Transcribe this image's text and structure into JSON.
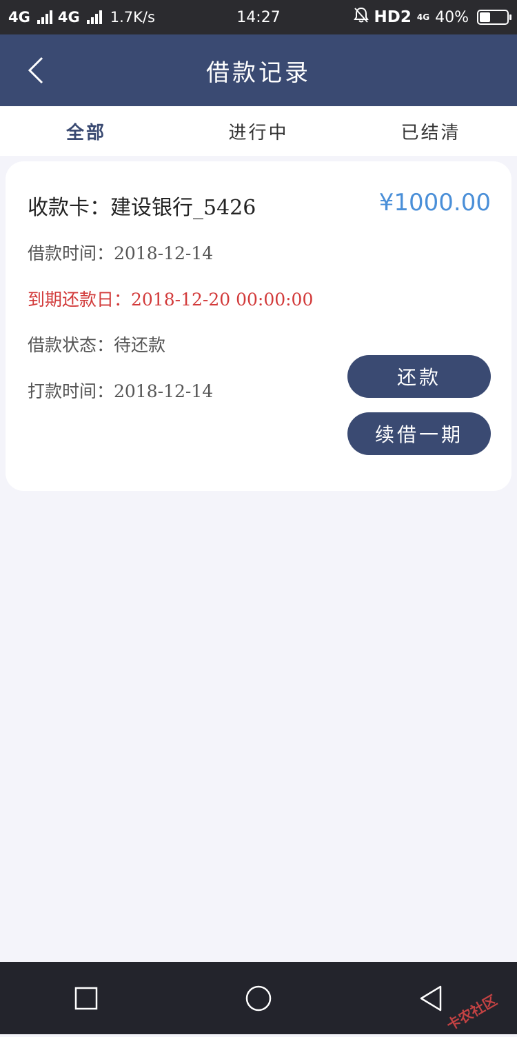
{
  "status_bar": {
    "network1": "4G",
    "network2": "4G",
    "speed": "1.7K/s",
    "time": "14:27",
    "hd_label": "HD2",
    "sim_label": "4G",
    "battery": "40%",
    "battery_level": 0.4
  },
  "header": {
    "title": "借款记录"
  },
  "tabs": [
    {
      "label": "全部",
      "active": true
    },
    {
      "label": "进行中",
      "active": false
    },
    {
      "label": "已结清",
      "active": false
    }
  ],
  "loan_card": {
    "card_label": "收款卡：建设银行_5426",
    "amount": "¥1000.00",
    "loan_time": "借款时间：2018-12-14",
    "due_date": "到期还款日：2018-12-20 00:00:00",
    "status": "借款状态：待还款",
    "payment_time": "打款时间：2018-12-14",
    "repay_button": "还款",
    "renew_button": "续借一期"
  },
  "colors": {
    "primary": "#3a4a72",
    "amount": "#4a8fd8",
    "due": "#d23a3a",
    "background": "#f4f4fa"
  },
  "watermark": {
    "text": "卡农社区"
  }
}
